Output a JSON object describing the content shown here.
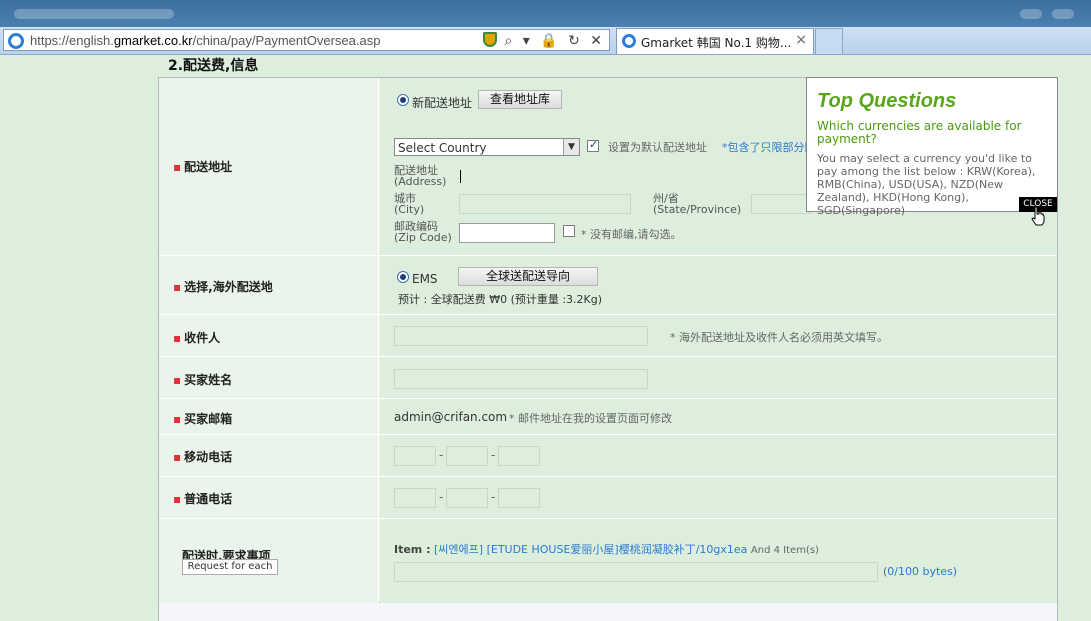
{
  "browser": {
    "url_prefix": "https://english.",
    "url_domain": "gmarket.co.kr",
    "url_path": "/china/pay/PaymentOversea.asp",
    "tab_title": "Gmarket 韩国 No.1 购物...",
    "tab_close": "×",
    "tools": "⌕ ▾ 🔒 ↻ ✕"
  },
  "section_title": "2.配送费,信息",
  "address_row": {
    "label": "配送地址",
    "new_address_radio": "新配送地址",
    "view_book_button": "查看地址库",
    "country_select": "Select Country",
    "default_label": "设置为默认配送地址",
    "default_note": "*包含了只限部分国",
    "address_label_cn": "配送地址",
    "address_label_en": "(Address)",
    "city_label_cn": "城市",
    "city_label_en": "(City)",
    "state_label_cn": "州/省",
    "state_label_en": "(State/Province)",
    "zip_label_cn": "邮政编码",
    "zip_label_en": "(Zip Code)",
    "no_zip_note": "* 没有邮编,请勾选。"
  },
  "shipping_row": {
    "label": "选择,海外配送地",
    "ems": "EMS",
    "guide_button": "全球送配送导向",
    "estimate": "预计 : 全球配送费 ₩0 (预计重量 :3.2Kg)"
  },
  "recipient_row": {
    "label": "收件人",
    "note": "* 海外配送地址及收件人名必须用英文填写。"
  },
  "buyer_name_row": {
    "label": "买家姓名"
  },
  "buyer_email_row": {
    "label": "买家邮箱",
    "email": "admin@crifan.com",
    "note": "* 邮件地址在我的设置页面可修改"
  },
  "mobile_row": {
    "label": "移动电话",
    "sep": "-"
  },
  "phone_row": {
    "label": "普通电话",
    "sep": "-"
  },
  "request_row": {
    "label": "配送时,要求事项",
    "request_button": "Request for each",
    "item_label": "Item :",
    "item_name": "[씨엔에프] [ETUDE HOUSE爱丽小屋]樱桃润凝胶补丁/10gx1ea",
    "item_more": "And 4 Item(s)",
    "bytes_open": "(",
    "bytes_count": "0",
    "bytes_rest": "/100 bytes)"
  },
  "popup": {
    "title": "Top Questions",
    "question": "Which currencies are available for payment?",
    "answer": "You may select a currency you'd like to pay among the list below : KRW(Korea), RMB(China), USD(USA), NZD(New Zealand), HKD(Hong Kong), SGD(Singapore)",
    "close": "CLOSE"
  },
  "colors": {
    "accent_green": "#5aa61a",
    "link_blue": "#2a7ad0",
    "required_red": "#e0303a"
  }
}
